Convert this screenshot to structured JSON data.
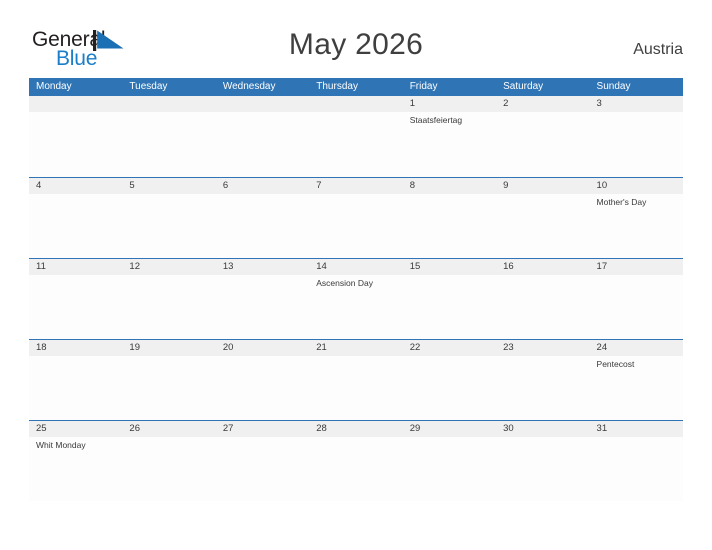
{
  "brand": {
    "name_part1": "General",
    "name_part2": "Blue",
    "flag_icon": "flag-triangle-icon",
    "color_dark": "#231f20",
    "color_blue": "#1b7ec8"
  },
  "header": {
    "title": "May 2026",
    "country": "Austria",
    "accent_color": "#2f74b5"
  },
  "calendar": {
    "weekdays": [
      "Monday",
      "Tuesday",
      "Wednesday",
      "Thursday",
      "Friday",
      "Saturday",
      "Sunday"
    ],
    "weeks": [
      [
        {
          "day": "",
          "events": []
        },
        {
          "day": "",
          "events": []
        },
        {
          "day": "",
          "events": []
        },
        {
          "day": "",
          "events": []
        },
        {
          "day": "1",
          "events": [
            "Staatsfeiertag"
          ]
        },
        {
          "day": "2",
          "events": []
        },
        {
          "day": "3",
          "events": []
        }
      ],
      [
        {
          "day": "4",
          "events": []
        },
        {
          "day": "5",
          "events": []
        },
        {
          "day": "6",
          "events": []
        },
        {
          "day": "7",
          "events": []
        },
        {
          "day": "8",
          "events": []
        },
        {
          "day": "9",
          "events": []
        },
        {
          "day": "10",
          "events": [
            "Mother's Day"
          ]
        }
      ],
      [
        {
          "day": "11",
          "events": []
        },
        {
          "day": "12",
          "events": []
        },
        {
          "day": "13",
          "events": []
        },
        {
          "day": "14",
          "events": [
            "Ascension Day"
          ]
        },
        {
          "day": "15",
          "events": []
        },
        {
          "day": "16",
          "events": []
        },
        {
          "day": "17",
          "events": []
        }
      ],
      [
        {
          "day": "18",
          "events": []
        },
        {
          "day": "19",
          "events": []
        },
        {
          "day": "20",
          "events": []
        },
        {
          "day": "21",
          "events": []
        },
        {
          "day": "22",
          "events": []
        },
        {
          "day": "23",
          "events": []
        },
        {
          "day": "24",
          "events": [
            "Pentecost"
          ]
        }
      ],
      [
        {
          "day": "25",
          "events": [
            "Whit Monday"
          ]
        },
        {
          "day": "26",
          "events": []
        },
        {
          "day": "27",
          "events": []
        },
        {
          "day": "28",
          "events": []
        },
        {
          "day": "29",
          "events": []
        },
        {
          "day": "30",
          "events": []
        },
        {
          "day": "31",
          "events": []
        }
      ]
    ]
  }
}
